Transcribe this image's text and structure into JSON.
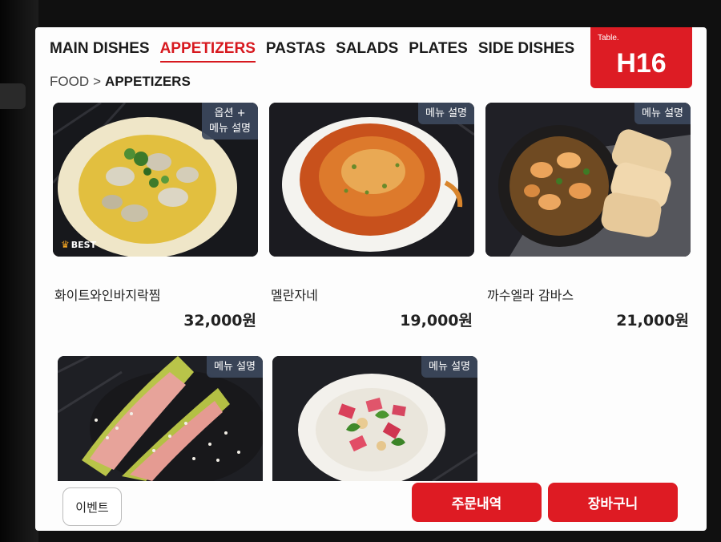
{
  "nav": {
    "tabs": [
      {
        "label": "MAIN DISHES",
        "active": false
      },
      {
        "label": "APPETIZERS",
        "active": true
      },
      {
        "label": "PASTAS",
        "active": false
      },
      {
        "label": "SALADS",
        "active": false
      },
      {
        "label": "PLATES",
        "active": false
      },
      {
        "label": "SIDE DISHES",
        "active": false
      }
    ]
  },
  "table": {
    "label": "Table.",
    "number": "H16"
  },
  "breadcrumb": {
    "root": "FOOD",
    "separator": ">",
    "current": "APPETIZERS"
  },
  "menu_items": [
    {
      "name": "화이트와인바지락찜",
      "price": "32,000원",
      "badge": "옵션 +\n메뉴 설명",
      "best": "BEST",
      "image": "clams-in-white-wine"
    },
    {
      "name": "멜란자네",
      "price": "19,000원",
      "badge": "메뉴 설명",
      "image": "melanzane-gratin"
    },
    {
      "name": "까수엘라 감바스",
      "price": "21,000원",
      "badge": "메뉴 설명",
      "image": "gambas-with-bread"
    },
    {
      "name": "",
      "price": "",
      "badge": "메뉴 설명",
      "image": "prosciutto-melon"
    },
    {
      "name": "",
      "price": "",
      "badge": "메뉴 설명",
      "image": "salad-bowl"
    }
  ],
  "footer": {
    "event_label": "이벤트",
    "orders_label": "주문내역",
    "cart_label": "장바구니"
  },
  "colors": {
    "accent": "#de1b23",
    "info_badge": "#3c485c",
    "screen_bg": "#fdfdfd"
  }
}
